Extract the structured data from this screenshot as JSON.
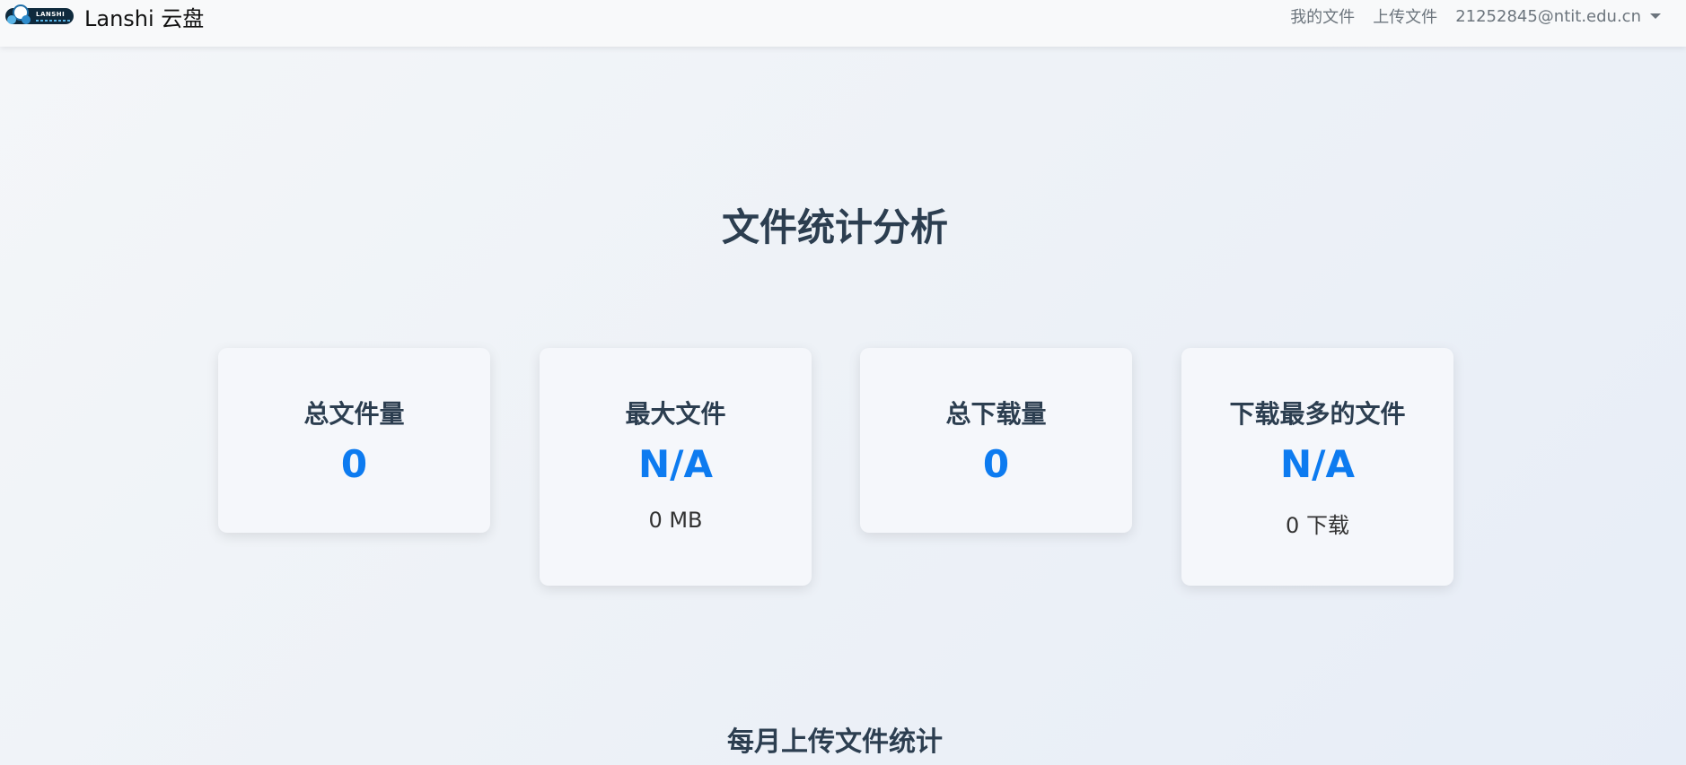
{
  "navbar": {
    "logo_text": "LANSHI",
    "brand_name": "Lanshi 云盘",
    "links": {
      "my_files": "我的文件",
      "upload": "上传文件"
    },
    "user_email": "21252845@ntit.edu.cn"
  },
  "main": {
    "title": "文件统计分析",
    "cards": {
      "total_files": {
        "title": "总文件量",
        "value": "0"
      },
      "largest_file": {
        "title": "最大文件",
        "value": "N/A",
        "sub": "0 MB"
      },
      "total_downloads": {
        "title": "总下载量",
        "value": "0"
      },
      "most_downloaded": {
        "title": "下载最多的文件",
        "value": "N/A",
        "sub": "0 下载"
      }
    },
    "monthly_section_title": "每月上传文件统计"
  },
  "colors": {
    "accent": "#0d7bf0",
    "heading": "#2c3e50",
    "nav_text": "#6c757d"
  }
}
